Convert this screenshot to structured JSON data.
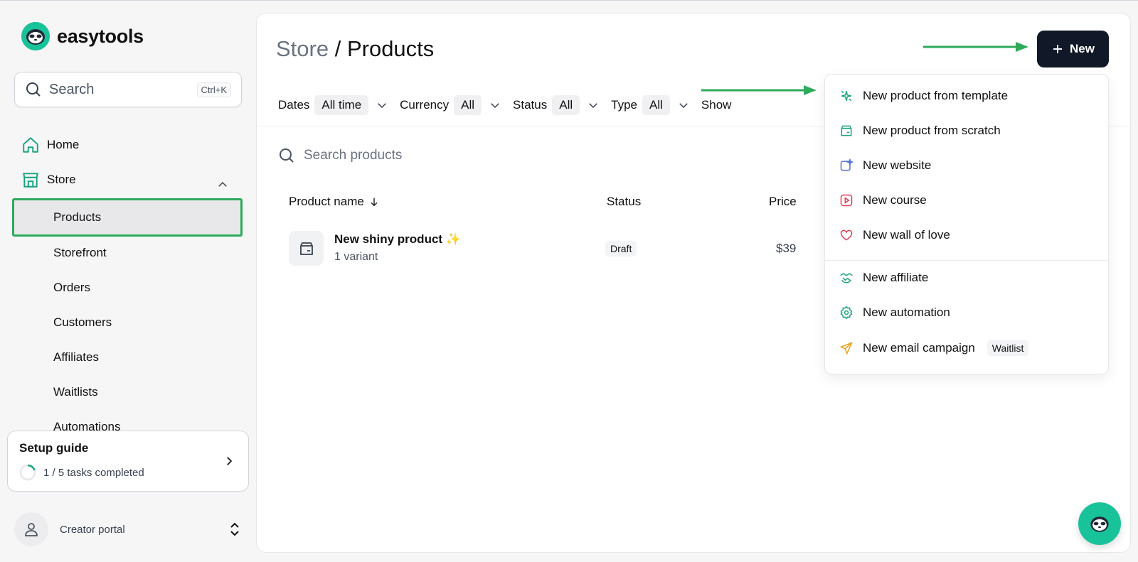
{
  "brand": {
    "name": "easytools"
  },
  "search": {
    "placeholder": "Search",
    "shortcut": "Ctrl+K"
  },
  "sidebar": {
    "home": "Home",
    "store": "Store",
    "items": [
      {
        "label": "Products",
        "active": true
      },
      {
        "label": "Storefront"
      },
      {
        "label": "Orders"
      },
      {
        "label": "Customers"
      },
      {
        "label": "Affiliates"
      },
      {
        "label": "Waitlists"
      },
      {
        "label": "Automations"
      }
    ]
  },
  "setup": {
    "title": "Setup guide",
    "progress_text": "1 / 5 tasks completed",
    "progress": 0.2
  },
  "portal": {
    "label": "Creator portal"
  },
  "header": {
    "crumb": "Store",
    "sep": " / ",
    "title": "Products",
    "new_label": "New"
  },
  "filters": [
    {
      "label": "Dates",
      "value": "All time"
    },
    {
      "label": "Currency",
      "value": "All"
    },
    {
      "label": "Status",
      "value": "All"
    },
    {
      "label": "Type",
      "value": "All"
    },
    {
      "label": "Show",
      "value": ""
    }
  ],
  "product_search": {
    "placeholder": "Search products"
  },
  "table": {
    "columns": [
      "Product name",
      "Status",
      "Price"
    ],
    "rows": [
      {
        "name": "New shiny product",
        "emoji": "✨",
        "variants": "1 variant",
        "status": "Draft",
        "price": "$39"
      }
    ]
  },
  "menu": {
    "items": [
      {
        "label": "New product from template",
        "icon": "sparkle-icon"
      },
      {
        "label": "New product from scratch",
        "icon": "box-icon"
      },
      {
        "label": "New website",
        "icon": "website-icon"
      },
      {
        "label": "New course",
        "icon": "play-icon"
      },
      {
        "label": "New wall of love",
        "icon": "heart-icon"
      },
      {
        "label": "New affiliate",
        "icon": "handshake-icon"
      },
      {
        "label": "New automation",
        "icon": "cog-icon"
      },
      {
        "label": "New email campaign",
        "icon": "paper-plane-icon",
        "badge": "Waitlist"
      }
    ]
  },
  "colors": {
    "accent": "#19c39a",
    "highlight": "#2eaa5c",
    "dark": "#111827"
  }
}
